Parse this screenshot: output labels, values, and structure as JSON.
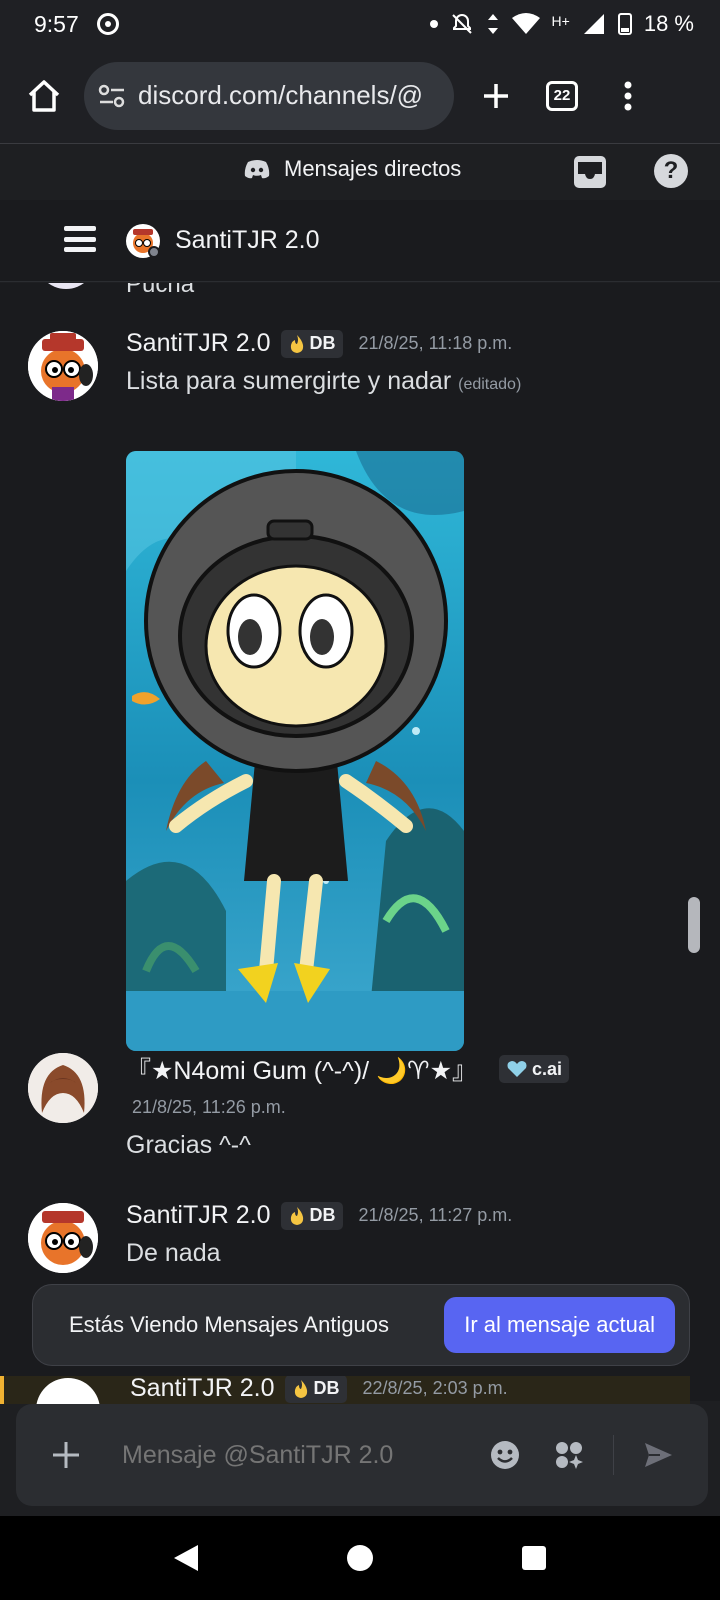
{
  "status_bar": {
    "time": "9:57",
    "network": "H+",
    "battery": "18 %"
  },
  "browser": {
    "url": "discord.com/channels/@",
    "tab_count": "22"
  },
  "dm_header": {
    "title": "Mensajes directos"
  },
  "channel": {
    "name": "SantiTJR 2.0"
  },
  "chat": {
    "cut_text": "Pucha",
    "messages": [
      {
        "author": "SantiTJR 2.0",
        "tag": "DB",
        "tag_icon": "flame-icon",
        "time": "21/8/25, 11:18 p.m.",
        "text": "Lista para sumergirte y nadar",
        "edited": "(editado)",
        "attachment": "underwater-diver-drawing"
      },
      {
        "author": "『★N4omi Gum (^-^)/ 🌙♈★』",
        "tag": "c.ai",
        "tag_icon": "heart-icon",
        "time": "21/8/25, 11:26 p.m.",
        "text": "Gracias ^-^"
      },
      {
        "author": "SantiTJR 2.0",
        "tag": "DB",
        "tag_icon": "flame-icon",
        "time": "21/8/25, 11:27 p.m.",
        "text": "De nada"
      },
      {
        "author": "SantiTJR 2.0",
        "tag": "DB",
        "tag_icon": "flame-icon",
        "time": "22/8/25, 2:03 p.m."
      }
    ]
  },
  "toast": {
    "text": "Estás Viendo Mensajes Antiguos",
    "button": "Ir al mensaje actual"
  },
  "composer": {
    "placeholder": "Mensaje @SantiTJR 2.0"
  },
  "colors": {
    "accent": "#5865f2",
    "background": "#1a1b1e",
    "highlight": "#f0b232"
  }
}
